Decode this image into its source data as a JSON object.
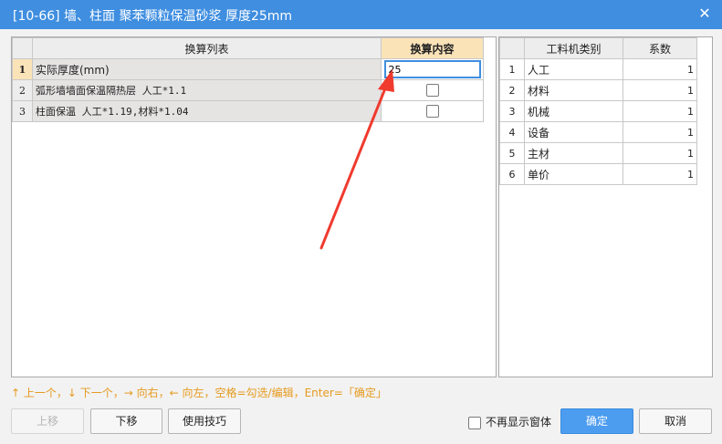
{
  "window": {
    "title": "[10-66] 墙、柱面 聚苯颗粒保温砂浆 厚度25mm",
    "close_icon": "close-icon"
  },
  "conversion_table": {
    "headers": {
      "list": "换算列表",
      "content": "换算内容"
    },
    "rows": [
      {
        "index": "1",
        "name": "实际厚度(mm)",
        "value": "25"
      },
      {
        "index": "2",
        "name": "弧形墙墙面保温隔热层 人工*1.1",
        "checked": false
      },
      {
        "index": "3",
        "name": "柱面保温 人工*1.19,材料*1.04",
        "checked": false
      }
    ]
  },
  "category_table": {
    "headers": {
      "category": "工料机类别",
      "coefficient": "系数"
    },
    "rows": [
      {
        "index": "1",
        "category": "人工",
        "coefficient": "1"
      },
      {
        "index": "2",
        "category": "材料",
        "coefficient": "1"
      },
      {
        "index": "3",
        "category": "机械",
        "coefficient": "1"
      },
      {
        "index": "4",
        "category": "设备",
        "coefficient": "1"
      },
      {
        "index": "5",
        "category": "主材",
        "coefficient": "1"
      },
      {
        "index": "6",
        "category": "单价",
        "coefficient": "1"
      }
    ]
  },
  "hint": "↑ 上一个，↓ 下一个，→ 向右，← 向左，空格=勾选/编辑，Enter=「确定」",
  "buttons": {
    "move_up": "上移",
    "move_down": "下移",
    "tips": "使用技巧",
    "ok": "确定",
    "cancel": "取消"
  },
  "dont_show": {
    "label": "不再显示窗体",
    "checked": false
  },
  "colors": {
    "titlebar": "#3f8ee0",
    "hint": "#e69a1e",
    "arrow": "#f03a2e",
    "active_header": "#fbe3b8"
  }
}
